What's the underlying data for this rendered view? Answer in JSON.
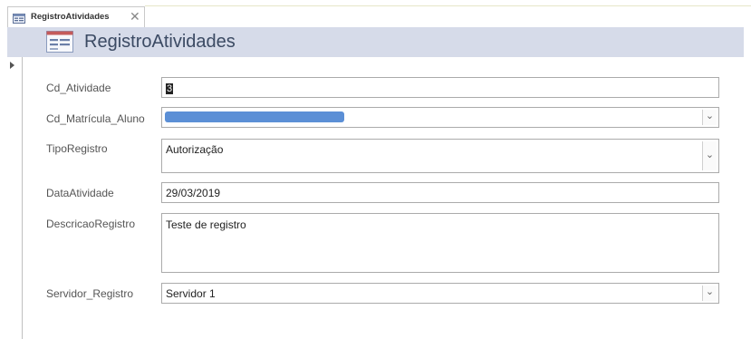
{
  "tab": {
    "label": "RegistroAtividades",
    "close": "✕"
  },
  "header": {
    "title": "RegistroAtividades"
  },
  "fields": {
    "cd_atividade": {
      "label": "Cd_Atividade",
      "value": "3"
    },
    "cd_matricula": {
      "label": "Cd_Matrícula_Aluno",
      "value": ""
    },
    "tipo_registro": {
      "label": "TipoRegistro",
      "value": "Autorização"
    },
    "data_atividade": {
      "label": "DataAtividade",
      "value": "29/03/2019"
    },
    "descricao_registro": {
      "label": "DescricaoRegistro",
      "value": "Teste de registro"
    },
    "servidor_registro": {
      "label": "Servidor_Registro",
      "value": "Servidor 1"
    }
  },
  "icons": {
    "dropdown": "chevron-down-icon",
    "record_selector": "record-arrow-icon",
    "form": "form-icon"
  },
  "colors": {
    "header_bg": "#d6dbe9",
    "title_text": "#3b4a63",
    "selection_highlight": "#5b8fd6"
  }
}
